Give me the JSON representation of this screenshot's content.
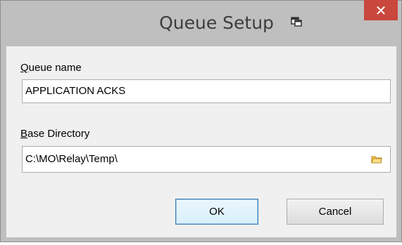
{
  "window": {
    "title": "Queue Setup",
    "close_glyph": "✕",
    "sysmenu_icon": "window-menu-icon",
    "close_color": "#c9473d"
  },
  "form": {
    "queue_name_label_access": "Q",
    "queue_name_label_rest": "ueue name",
    "queue_name_value": "APPLICATION ACKS",
    "base_dir_label_access": "B",
    "base_dir_label_rest": "ase Directory",
    "base_dir_value": "C:\\MO\\Relay\\Temp\\",
    "browse_icon": "folder-icon"
  },
  "buttons": {
    "ok_label": "OK",
    "cancel_label": "Cancel"
  }
}
